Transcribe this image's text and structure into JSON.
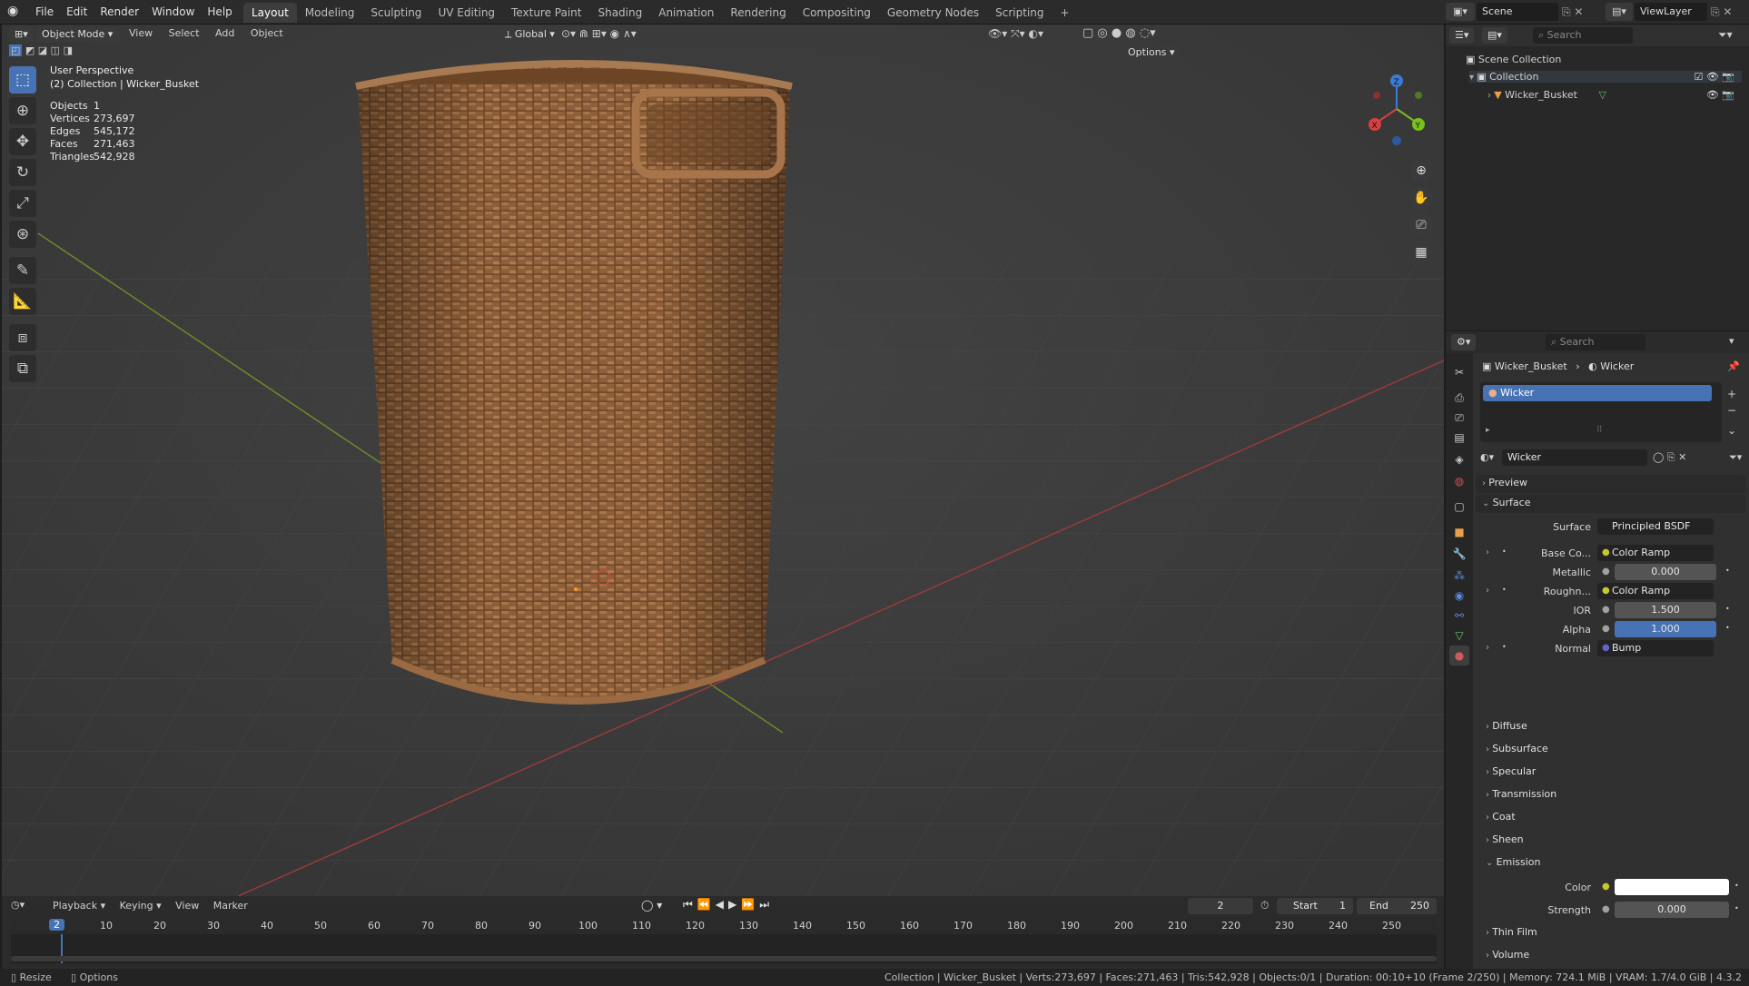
{
  "topbar": {
    "menus": [
      "File",
      "Edit",
      "Render",
      "Window",
      "Help"
    ],
    "workspaces": [
      "Layout",
      "Modeling",
      "Sculpting",
      "UV Editing",
      "Texture Paint",
      "Shading",
      "Animation",
      "Rendering",
      "Compositing",
      "Geometry Nodes",
      "Scripting"
    ],
    "active_workspace": "Layout",
    "add_tab": "+",
    "scene_label": "Scene",
    "viewlayer_label": "ViewLayer"
  },
  "viewport": {
    "mode": "Object Mode",
    "menus": [
      "View",
      "Select",
      "Add",
      "Object"
    ],
    "transform_orientation": "Global",
    "options_label": "Options",
    "perspective_label": "User Perspective",
    "collection_object": "(2) Collection | Wicker_Busket",
    "stats": [
      {
        "label": "Objects",
        "value": "1"
      },
      {
        "label": "Vertices",
        "value": "273,697"
      },
      {
        "label": "Edges",
        "value": "545,172"
      },
      {
        "label": "Faces",
        "value": "271,463"
      },
      {
        "label": "Triangles",
        "value": "542,928"
      }
    ],
    "gizmo_axes": {
      "x": "X",
      "y": "Y",
      "z": "Z"
    }
  },
  "outliner": {
    "search_placeholder": "Search",
    "items": [
      {
        "label": "Scene Collection"
      },
      {
        "label": "Collection"
      },
      {
        "label": "Wicker_Busket"
      }
    ]
  },
  "properties": {
    "search_placeholder": "Search",
    "breadcrumb_object": "Wicker_Busket",
    "breadcrumb_material": "Wicker",
    "material_slot": "Wicker",
    "material_name": "Wicker",
    "panels": {
      "preview": "Preview",
      "surface": "Surface"
    },
    "rows": [
      {
        "label": "Surface",
        "value": "Principled BSDF",
        "dot": "#4caf50"
      },
      {
        "label": "Base Co...",
        "value": "Color Ramp",
        "dot": "#c7c729"
      },
      {
        "label": "Metallic",
        "value": "0.000",
        "dot": "#a1a1a1"
      },
      {
        "label": "Roughn...",
        "value": "Color Ramp",
        "dot": "#c7c729"
      },
      {
        "label": "IOR",
        "value": "1.500",
        "dot": "#a1a1a1"
      },
      {
        "label": "Alpha",
        "value": "1.000",
        "dot": "#a1a1a1"
      },
      {
        "label": "Normal",
        "value": "Bump",
        "dot": "#6363c7"
      }
    ],
    "subpanels": [
      "Diffuse",
      "Subsurface",
      "Specular",
      "Transmission",
      "Coat",
      "Sheen",
      "Emission"
    ],
    "emission_rows": [
      {
        "label": "Color",
        "value": "",
        "dot": "#c7c729"
      },
      {
        "label": "Strength",
        "value": "0.000",
        "dot": "#a1a1a1"
      }
    ],
    "after": [
      "Thin Film",
      "Volume"
    ]
  },
  "timeline": {
    "menus": [
      "Playback",
      "Keying",
      "View",
      "Marker"
    ],
    "current_frame": "2",
    "start_label": "Start",
    "start_value": "1",
    "end_label": "End",
    "end_value": "250",
    "ticks": [
      "2",
      "10",
      "20",
      "30",
      "40",
      "50",
      "60",
      "70",
      "80",
      "90",
      "100",
      "110",
      "120",
      "130",
      "140",
      "150",
      "160",
      "170",
      "180",
      "190",
      "200",
      "210",
      "220",
      "230",
      "240",
      "250"
    ]
  },
  "statusbar": {
    "left_items": [
      "Resize",
      "Options"
    ],
    "info": "Collection | Wicker_Busket | Verts:273,697 | Faces:271,463 | Tris:542,928 | Objects:0/1 | Duration: 00:10+10 (Frame 2/250) | Memory: 724.1 MiB | VRAM: 1.7/4.0 GiB | 4.3.2"
  },
  "colors": {
    "accent": "#4772b3",
    "basket_main": "#9a6a42",
    "basket_dark": "#6b4526"
  }
}
